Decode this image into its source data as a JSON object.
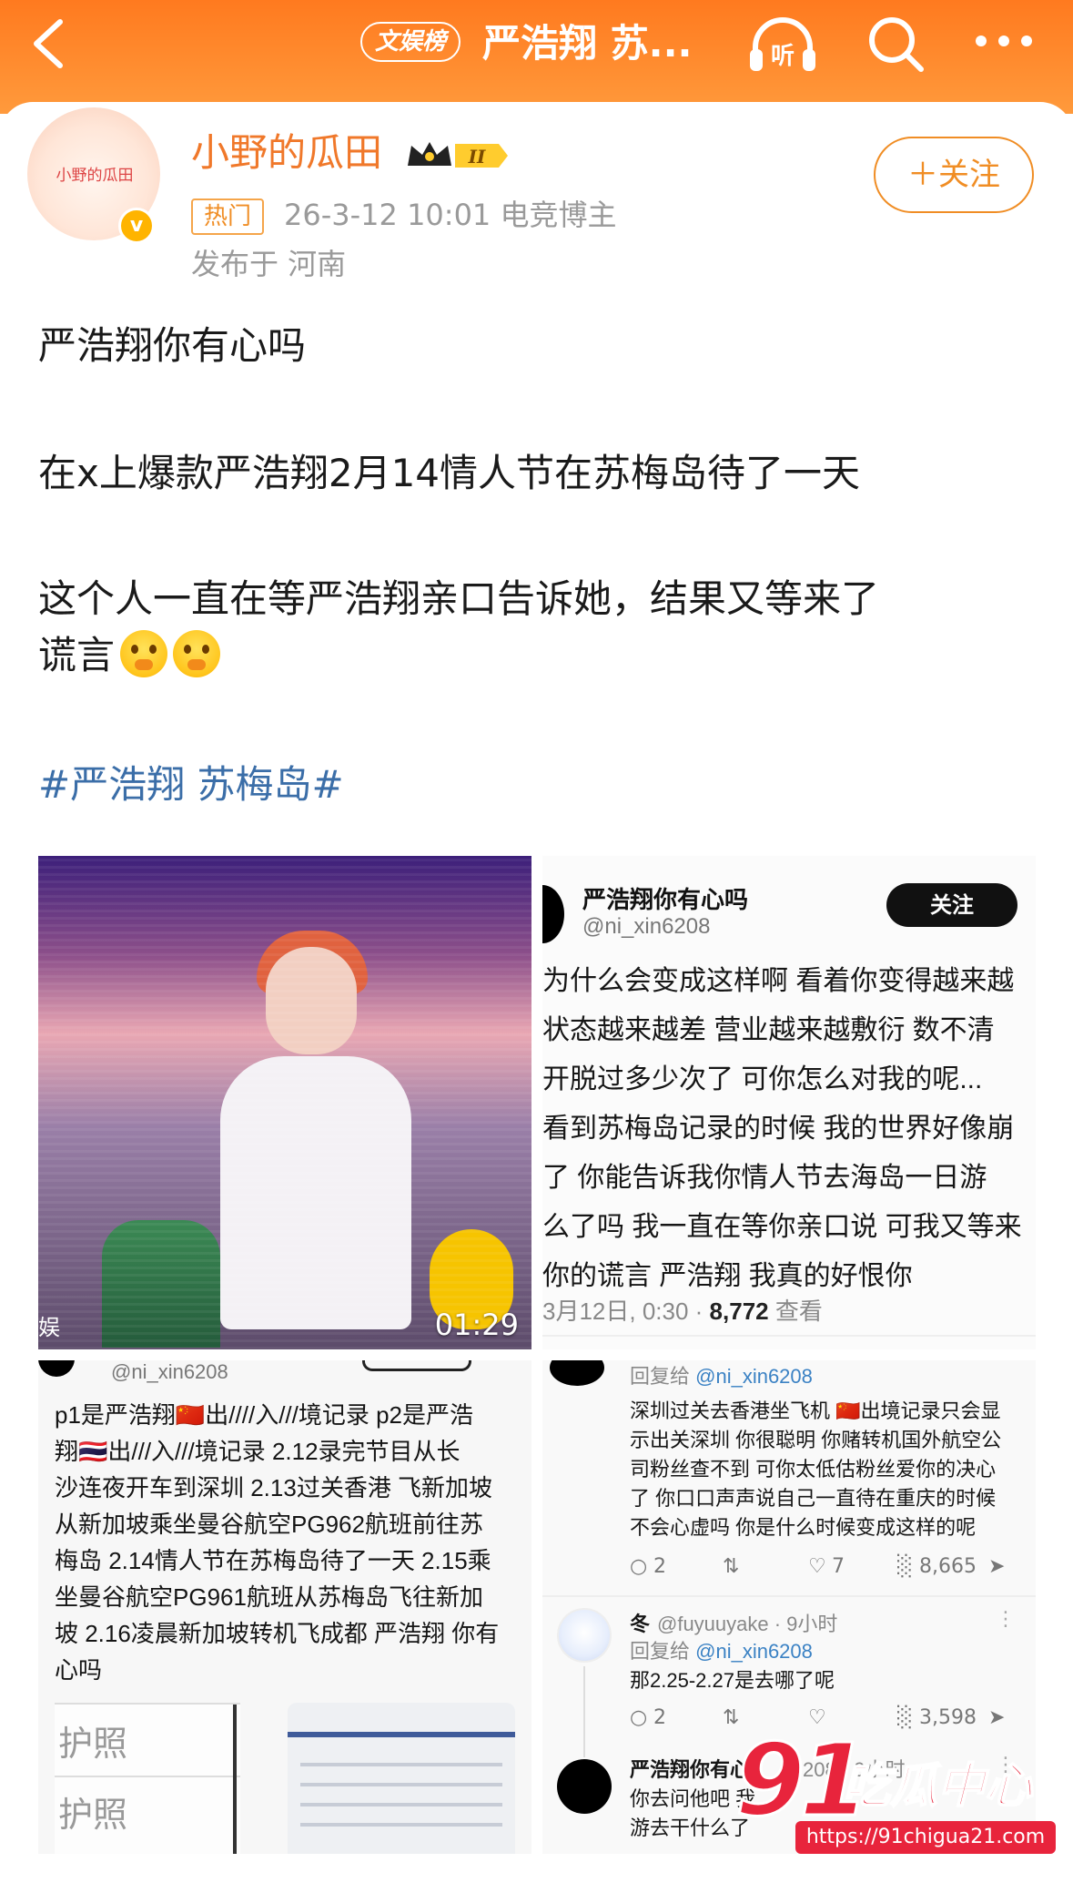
{
  "colors": {
    "brand_orange": "#ff8a2b",
    "hashtag_blue": "#3b6ea8",
    "name_orange": "#f0782a",
    "watermark_red": "#e8243c"
  },
  "header": {
    "back_icon": "chevron-left-icon",
    "tag_badge": "文娱榜",
    "topic_title": "严浩翔 苏...",
    "listen_icon": "headphones-icon",
    "listen_label": "听",
    "search_icon": "search-icon",
    "more_icon": "more-dots-icon"
  },
  "author": {
    "avatar_text": "小野的瓜田",
    "verified_icon": "verified-v-icon",
    "verified_label": "v",
    "name": "小野的瓜田",
    "level_icon": "crown-level-icon",
    "level": "II",
    "hot_badge": "热门",
    "time_role": "26-3-12 10:01  电竞博主",
    "location": "发布于 河南",
    "follow_label": "＋关注"
  },
  "post": {
    "line1": "严浩翔你有心吗",
    "line2": "在x上爆款严浩翔2月14情人节在苏梅岛待了一天",
    "line3": "这个人一直在等严浩翔亲口告诉她，结果又等来了",
    "line4": "谎言",
    "emoji_icon": "crying-face-emoji",
    "hashtag": "#严浩翔 苏梅岛#"
  },
  "images": {
    "video": {
      "duration": "01:29",
      "corner_text": "娱"
    },
    "screenshot1": {
      "name": "严浩翔你有心吗",
      "handle": "@ni_xin6208",
      "follow": "关注",
      "body": [
        "为什么会变成这样啊 看着你变得越来越",
        "状态越来越差 营业越来越敷衍 数不清",
        "开脱过多少次了 可你怎么对我的呢...",
        "看到苏梅岛记录的时候 我的世界好像崩",
        "了 你能告诉我你情人节去海岛一日游",
        "么了吗 我一直在等你亲口说 可我又等来",
        "你的谎言 严浩翔 我真的好恨你"
      ],
      "meta_prefix": "3月12日, 0:30 · ",
      "views": "8,772",
      "meta_suffix": " 查看"
    },
    "screenshot2": {
      "handle": "@ni_xin6208",
      "body": [
        "p1是严浩翔🇨🇳出////入///境记录 p2是严浩",
        "翔🇹🇭出///入///境记录  2.12录完节目从长",
        "沙连夜开车到深圳 2.13过关香港 飞新加坡",
        "从新加坡乘坐曼谷航空PG962航班前往苏",
        "梅岛  2.14情人节在苏梅岛待了一天 2.15乘",
        "坐曼谷航空PG961航班从苏梅岛飞往新加",
        "坡 2.16凌晨新加坡转机飞成都 严浩翔 你有"
      ],
      "body_last": "心吗",
      "passport1": "护照",
      "passport2": "护照"
    },
    "screenshot3": {
      "reply_label": "回复给 ",
      "reply_handle": "@ni_xin6208",
      "body": [
        "深圳过关去香港坐飞机 🇨🇳出境记录只会显",
        "示出关深圳 你很聪明 你赌转机国外航空公",
        "司粉丝查不到 可你太低估粉丝爱你的决心",
        "了 你口口声声说自己一直待在重庆的时候",
        "不会心虚吗 你是什么时候变成这样的呢"
      ],
      "actions1": {
        "replies": "2",
        "likes": "7",
        "views": "8,665"
      },
      "user2_name": "冬",
      "user2_handle": "@fuyuuyake · 9小时",
      "user2_reply": "回复给 ",
      "user2_reply_handle": "@ni_xin6208",
      "user2_body": "那2.25-2.27是去哪了呢",
      "actions2": {
        "replies": "2",
        "views": "3,598"
      },
      "user3_name": "严浩翔你有心",
      "user3_handle": "208 · 9小时",
      "user3_body1": "你去问他吧 我",
      "user3_body2": "游去干什么了",
      "reply_icon": "comment-icon",
      "retweet_icon": "repost-icon",
      "like_icon": "heart-icon",
      "views_icon": "bar-chart-icon",
      "share_icon": "share-icon",
      "kebab": "⋮"
    }
  },
  "watermark": {
    "logo": "91",
    "title": "吃瓜中心",
    "url": "https://91chigua21.com"
  }
}
